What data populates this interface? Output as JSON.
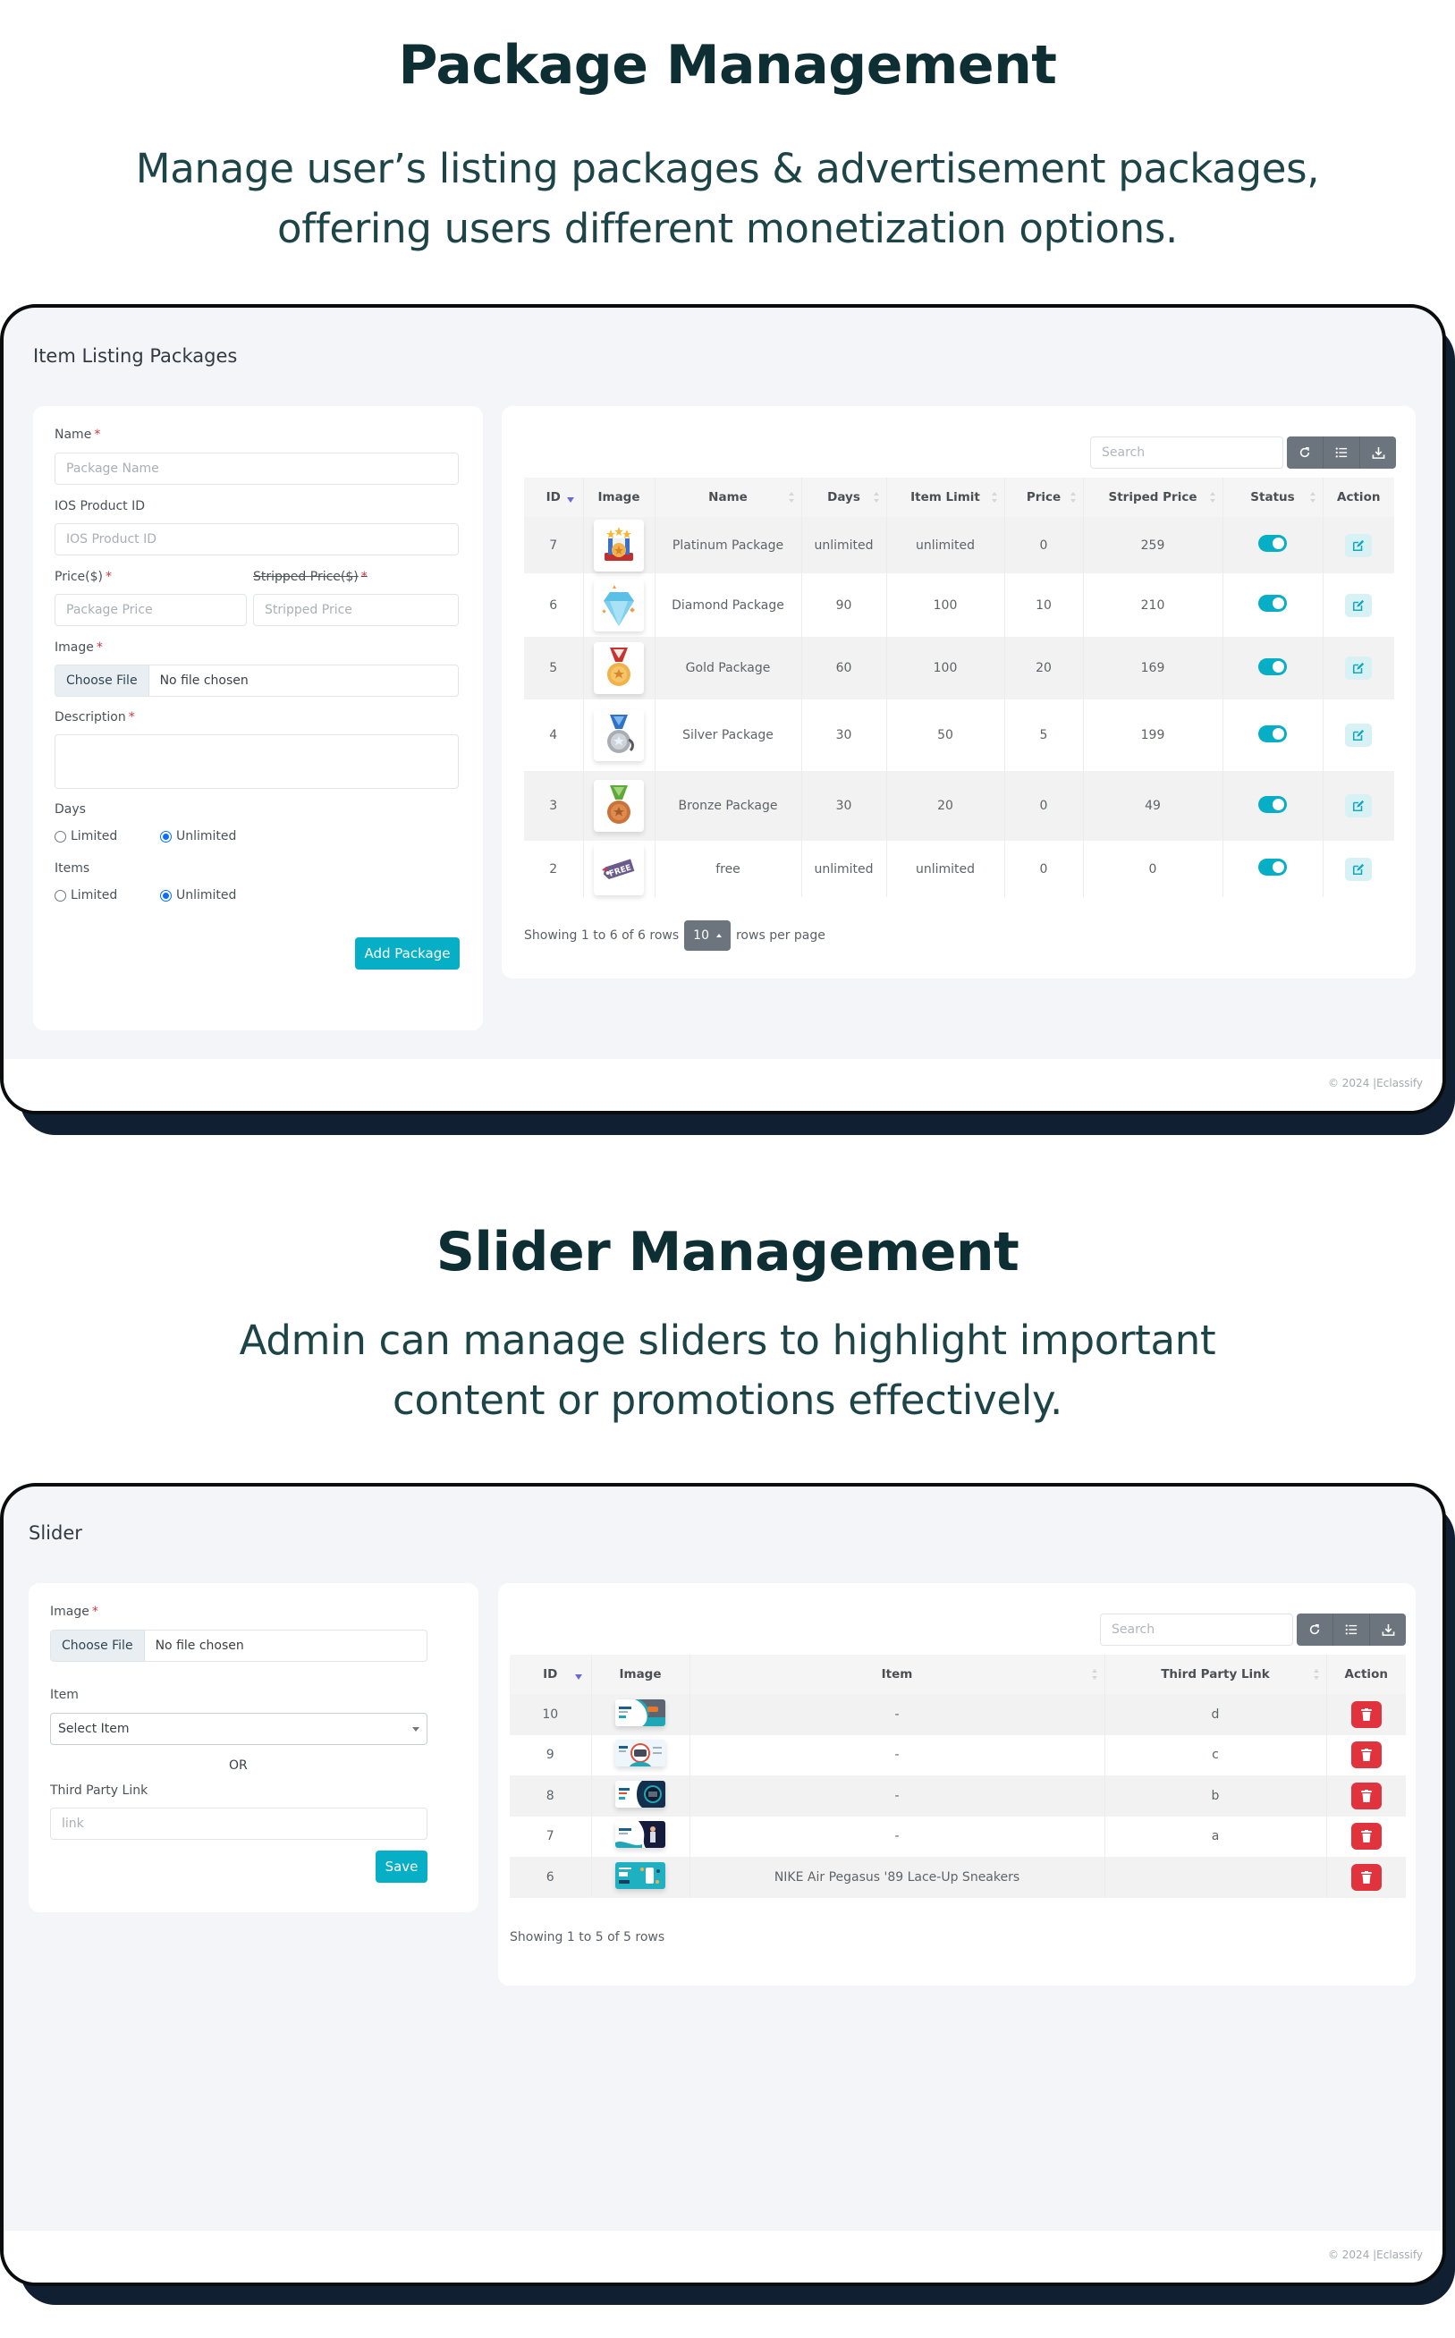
{
  "sections": {
    "packages": {
      "heading": "Package Management",
      "subtitle_lines": [
        "Manage user’s listing packages & advertisement packages,",
        "offering users different monetization options."
      ]
    },
    "slider": {
      "heading": "Slider Management",
      "subtitle_lines": [
        "Admin can manage sliders to highlight important",
        "content or promotions effectively."
      ]
    }
  },
  "package_page": {
    "title": "Item Listing Packages",
    "form": {
      "name_label": "Name",
      "name_placeholder": "Package Name",
      "ios_label": "IOS Product ID",
      "ios_placeholder": "IOS Product ID",
      "price_label": "Price($)",
      "price_placeholder": "Package Price",
      "stripped_label": "Stripped Price($)",
      "stripped_placeholder": "Stripped Price",
      "image_label": "Image",
      "choose_file": "Choose File",
      "no_file": "No file chosen",
      "description_label": "Description",
      "description_value": "",
      "days_label": "Days",
      "days_options": [
        "Limited",
        "Unlimited"
      ],
      "days_selected": "Unlimited",
      "items_label": "Items",
      "items_options": [
        "Limited",
        "Unlimited"
      ],
      "items_selected": "Unlimited",
      "submit_label": "Add Package",
      "required_mark": "*"
    },
    "table": {
      "search_placeholder": "Search",
      "toolbar": [
        "refresh-icon",
        "columns-icon",
        "export-icon"
      ],
      "columns": [
        "ID",
        "Image",
        "Name",
        "Days",
        "Item Limit",
        "Price",
        "Striped Price",
        "Status",
        "Action"
      ],
      "rows": [
        {
          "id": "7",
          "image": "platinum-medal",
          "name": "Platinum Package",
          "days": "unlimited",
          "item_limit": "unlimited",
          "price": "0",
          "striped_price": "259",
          "status": true
        },
        {
          "id": "6",
          "image": "diamond",
          "name": "Diamond Package",
          "days": "90",
          "item_limit": "100",
          "price": "10",
          "striped_price": "210",
          "status": true
        },
        {
          "id": "5",
          "image": "gold-medal",
          "name": "Gold Package",
          "days": "60",
          "item_limit": "100",
          "price": "20",
          "striped_price": "169",
          "status": true
        },
        {
          "id": "4",
          "image": "silver-medal",
          "name": "Silver Package",
          "days": "30",
          "item_limit": "50",
          "price": "5",
          "striped_price": "199",
          "status": true
        },
        {
          "id": "3",
          "image": "bronze-medal",
          "name": "Bronze Package",
          "days": "30",
          "item_limit": "20",
          "price": "0",
          "striped_price": "49",
          "status": true
        },
        {
          "id": "2",
          "image": "free-tag",
          "name": "free",
          "days": "unlimited",
          "item_limit": "unlimited",
          "price": "0",
          "striped_price": "0",
          "status": true
        }
      ],
      "showing_text": "Showing 1 to 6 of 6 rows",
      "page_size": "10",
      "rows_per_page_text": "rows per page"
    },
    "footer": "© 2024 |Eclassify"
  },
  "slider_page": {
    "title": "Slider",
    "form": {
      "image_label": "Image",
      "choose_file": "Choose File",
      "no_file": "No file chosen",
      "item_label": "Item",
      "item_select_value": "Select Item",
      "or_text": "OR",
      "link_label": "Third Party Link",
      "link_placeholder": "link",
      "submit_label": "Save",
      "required_mark": "*"
    },
    "table": {
      "search_placeholder": "Search",
      "toolbar": [
        "refresh-icon",
        "columns-icon",
        "export-icon"
      ],
      "columns": [
        "ID",
        "Image",
        "Item",
        "Third Party Link",
        "Action"
      ],
      "rows": [
        {
          "id": "10",
          "image": "banner-teal-sofa",
          "item": "-",
          "link": "d"
        },
        {
          "id": "9",
          "image": "banner-car",
          "item": "-",
          "link": "c"
        },
        {
          "id": "8",
          "image": "banner-laptop",
          "item": "-",
          "link": "b"
        },
        {
          "id": "7",
          "image": "banner-person-dark",
          "item": "-",
          "link": "a"
        },
        {
          "id": "6",
          "image": "banner-teal-phone",
          "item": "NIKE Air Pegasus '89 Lace-Up Sneakers",
          "link": ""
        }
      ],
      "showing_text": "Showing 1 to 5 of 5 rows"
    },
    "footer": "© 2024 |Eclassify"
  },
  "colors": {
    "accent": "#06afc5",
    "danger": "#e0333e",
    "heading": "#0d2e32",
    "frame_shadow": "#111f33",
    "page_bg": "#f4f5f8"
  }
}
